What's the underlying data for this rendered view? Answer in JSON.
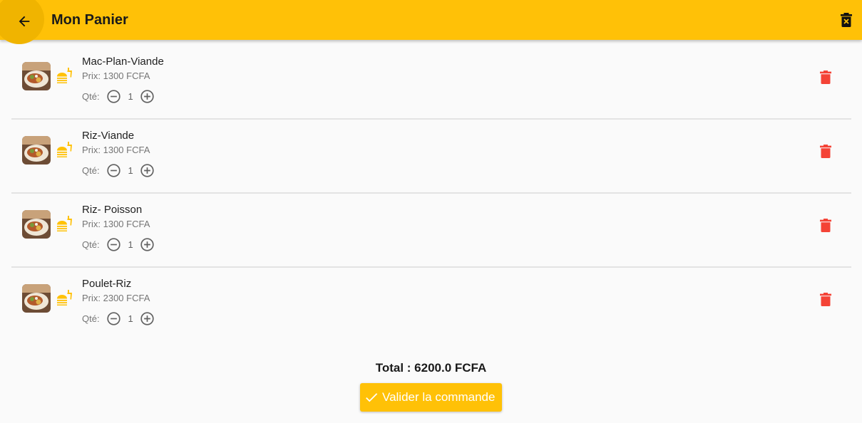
{
  "colors": {
    "app_bar": "#ffc107",
    "accent": "#ffc107",
    "delete": "#f44336",
    "text_secondary": "#757575"
  },
  "app_bar": {
    "title": "Mon Panier",
    "back_icon": "arrow-back-icon",
    "clear_icon": "delete-forever-icon"
  },
  "cart": {
    "items": [
      {
        "name": "Mac-Plan-Viande",
        "price": "Prix: 1300 FCFA",
        "qty_label": "Qté:",
        "qty": "1",
        "thumb_icon": "food-photo"
      },
      {
        "name": "Riz-Viande",
        "price": "Prix: 1300 FCFA",
        "qty_label": "Qté:",
        "qty": "1",
        "thumb_icon": "food-photo"
      },
      {
        "name": "Riz- Poisson",
        "price": "Prix: 1300 FCFA",
        "qty_label": "Qté:",
        "qty": "1",
        "thumb_icon": "food-photo"
      },
      {
        "name": "Poulet-Riz",
        "price": "Prix: 2300 FCFA",
        "qty_label": "Qté:",
        "qty": "1",
        "thumb_icon": "food-photo"
      }
    ]
  },
  "summary": {
    "total": "Total : 6200.0 FCFA",
    "validate_label": "Valider la commande"
  }
}
